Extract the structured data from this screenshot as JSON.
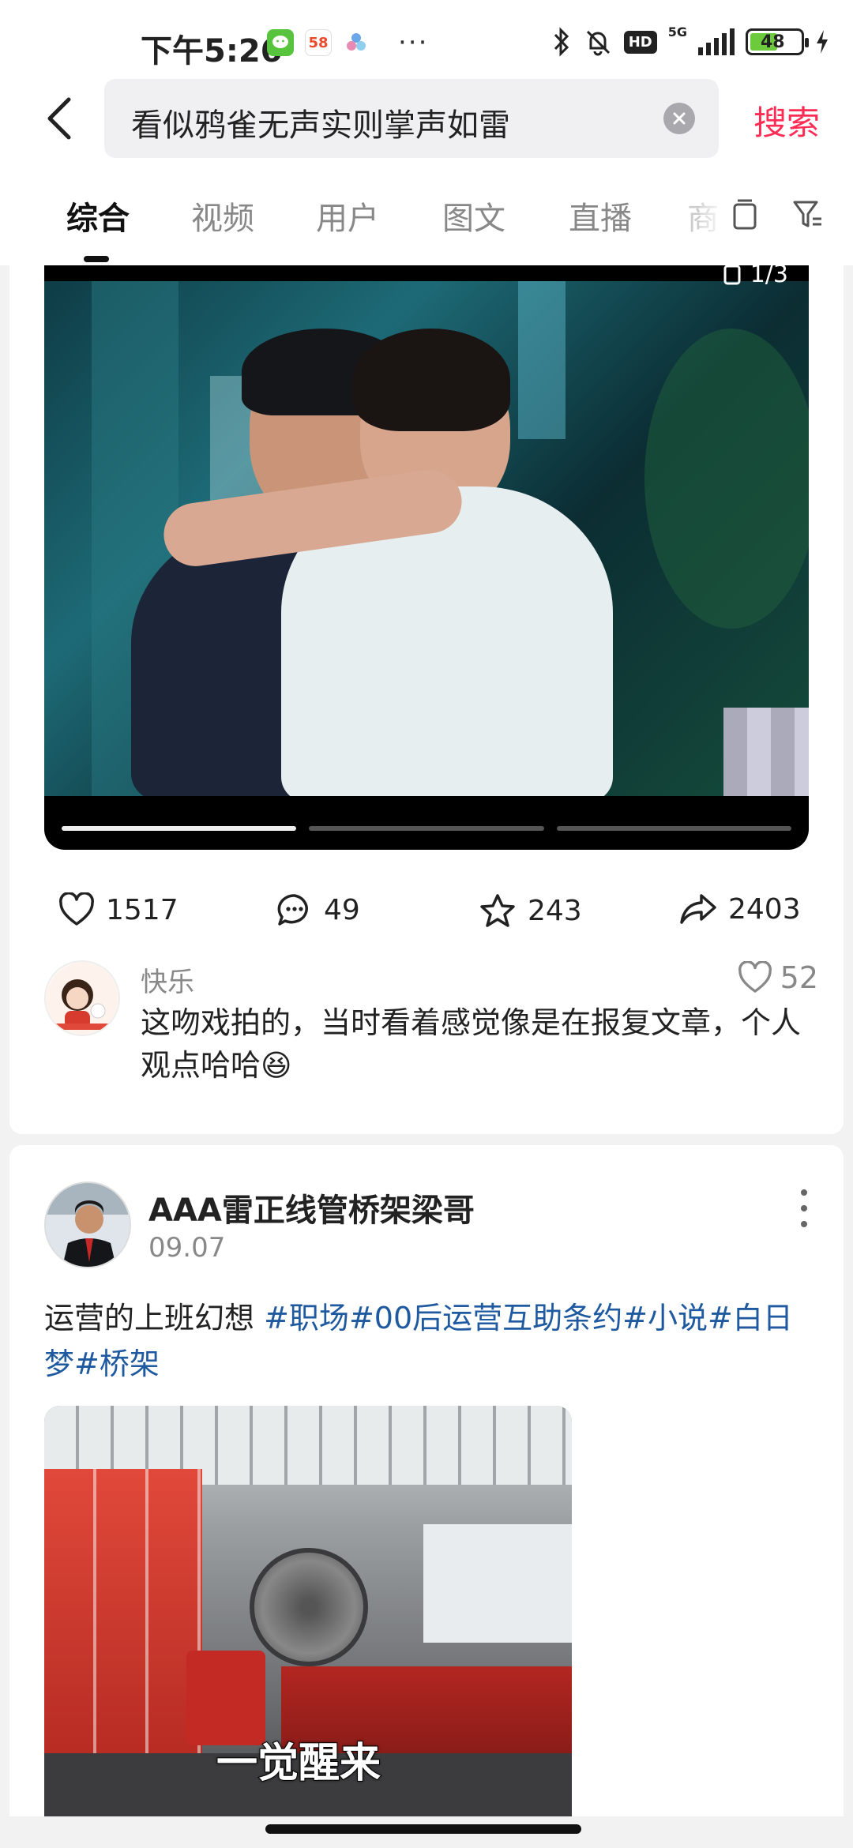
{
  "status_bar": {
    "time": "下午5:26",
    "app_icons": [
      {
        "name": "wechat-icon",
        "label": "",
        "color": "#58c33c"
      },
      {
        "name": "app-58-icon",
        "label": "58",
        "color": "#e94b2b"
      },
      {
        "name": "flower-app-icon",
        "label": "",
        "color": "#6aa6e8"
      }
    ],
    "more": "···",
    "network": "5G",
    "hd": "HD",
    "battery": "48"
  },
  "search": {
    "query": "看似鸦雀无声实则掌声如雷",
    "submit_label": "搜索"
  },
  "tabs": [
    {
      "label": "综合",
      "active": true
    },
    {
      "label": "视频",
      "active": false
    },
    {
      "label": "用户",
      "active": false
    },
    {
      "label": "图文",
      "active": false
    },
    {
      "label": "直播",
      "active": false
    },
    {
      "label": "商",
      "active": false
    }
  ],
  "post1": {
    "image_counter": "1/3",
    "slides_total": 3,
    "slide_current": 1,
    "likes": "1517",
    "comments": "49",
    "favorites": "243",
    "shares": "2403",
    "top_comment": {
      "user": "快乐",
      "likes": "52",
      "text": "这吻戏拍的，当时看着感觉像是在报复文章，个人观点哈哈",
      "emoji": "😆"
    }
  },
  "post2": {
    "author": "AAA雷正线管桥架梁哥",
    "date": "09.07",
    "text": "运营的上班幻想 ",
    "tags": [
      "#职场",
      "#00后运营互助条约",
      "#小说",
      "#白日梦",
      "#桥架"
    ],
    "caption": "一觉醒来"
  },
  "colors": {
    "accent": "#fe2c55",
    "tag": "#1f5aa0"
  }
}
